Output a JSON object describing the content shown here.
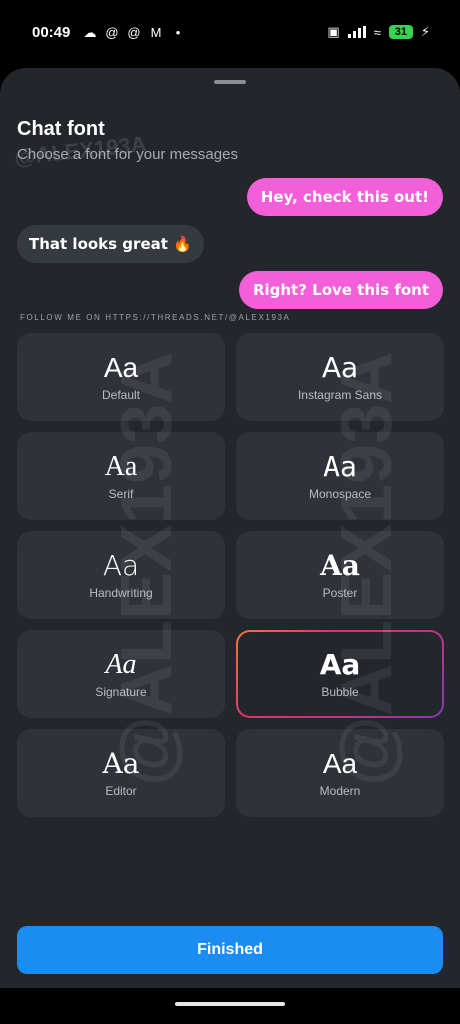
{
  "status_bar": {
    "time": "00:49",
    "battery": "31"
  },
  "sheet": {
    "title": "Chat font",
    "subtitle": "Choose a font for your messages"
  },
  "messages": {
    "outgoing_1": "Hey, check this out!",
    "incoming_1": "That looks great 🔥",
    "outgoing_2": "Right? Love this font"
  },
  "watermark": {
    "follow_text": "FOLLOW ME ON HTTPS://THREADS.NET/@ALEX193A",
    "handle": "@ALEX193A"
  },
  "fonts": [
    {
      "sample": "Aa",
      "label": "Default"
    },
    {
      "sample": "Aa",
      "label": "Instagram Sans"
    },
    {
      "sample": "Aa",
      "label": "Serif"
    },
    {
      "sample": "Aa",
      "label": "Monospace"
    },
    {
      "sample": "Aa",
      "label": "Handwriting"
    },
    {
      "sample": "Aa",
      "label": "Poster"
    },
    {
      "sample": "Aa",
      "label": "Signature"
    },
    {
      "sample": "Aa",
      "label": "Bubble",
      "selected": true
    },
    {
      "sample": "Aa",
      "label": "Editor"
    },
    {
      "sample": "Aa",
      "label": "Modern"
    }
  ],
  "finish_button": "Finished",
  "colors": {
    "accent": "#1a8cf2",
    "bubble_out": "#f25fd8",
    "sheet_bg": "#23262b"
  }
}
